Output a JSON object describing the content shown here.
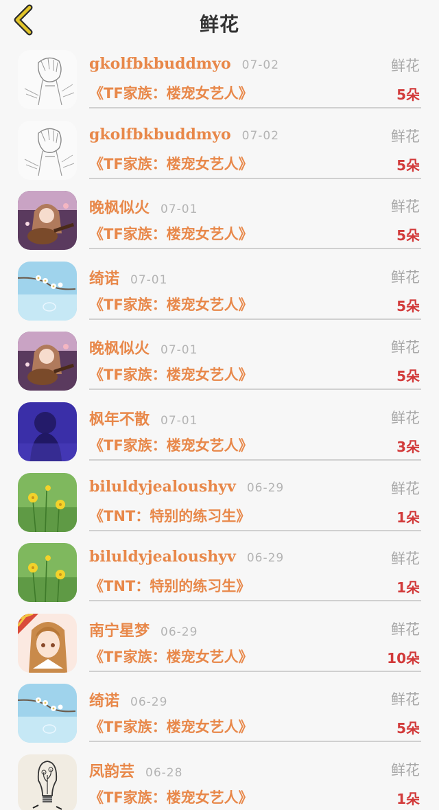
{
  "header": {
    "title": "鲜花",
    "back_icon": "chevron-left-icon",
    "accent": "#e2c52a"
  },
  "colors": {
    "username": "#e8884a",
    "book": "#e8884a",
    "count": "#d23a3a",
    "date": "#b4b4b4",
    "gift": "#a8a8a8"
  },
  "records": [
    {
      "user": "gkolfbkbuddmyo",
      "date": "07-02",
      "gift": "鲜花",
      "book": "《TF家族：楼宠女艺人》",
      "count": "5朵",
      "avatar": "sketch-boy-avatar"
    },
    {
      "user": "gkolfbkbuddmyo",
      "date": "07-02",
      "gift": "鲜花",
      "book": "《TF家族：楼宠女艺人》",
      "count": "5朵",
      "avatar": "sketch-boy-avatar"
    },
    {
      "user": "晚枫似火",
      "date": "07-01",
      "gift": "鲜花",
      "book": "《TF家族：楼宠女艺人》",
      "count": "5朵",
      "avatar": "guitar-girl-avatar"
    },
    {
      "user": "绮诺",
      "date": "07-01",
      "gift": "鲜花",
      "book": "《TF家族：楼宠女艺人》",
      "count": "5朵",
      "avatar": "blossom-sky-avatar"
    },
    {
      "user": "晚枫似火",
      "date": "07-01",
      "gift": "鲜花",
      "book": "《TF家族：楼宠女艺人》",
      "count": "5朵",
      "avatar": "guitar-girl-avatar"
    },
    {
      "user": "枫年不散",
      "date": "07-01",
      "gift": "鲜花",
      "book": "《TF家族：楼宠女艺人》",
      "count": "3朵",
      "avatar": "purple-silhouette-avatar"
    },
    {
      "user": "biluldyjealoushyv",
      "date": "06-29",
      "gift": "鲜花",
      "book": "《TNT：特别的练习生》",
      "count": "1朵",
      "avatar": "yellow-flowers-avatar"
    },
    {
      "user": "biluldyjealoushyv",
      "date": "06-29",
      "gift": "鲜花",
      "book": "《TNT：特别的练习生》",
      "count": "1朵",
      "avatar": "yellow-flowers-avatar"
    },
    {
      "user": "南宁星梦",
      "date": "06-29",
      "gift": "鲜花",
      "book": "《TF家族：楼宠女艺人》",
      "count": "10朵",
      "avatar": "anime-girl-avatar"
    },
    {
      "user": "绮诺",
      "date": "06-29",
      "gift": "鲜花",
      "book": "《TF家族：楼宠女艺人》",
      "count": "5朵",
      "avatar": "blossom-sky-avatar"
    },
    {
      "user": "凤韵芸",
      "date": "06-28",
      "gift": "鲜花",
      "book": "《TF家族：楼宠女艺人》",
      "count": "1朵",
      "avatar": "lightbulb-sketch-avatar"
    }
  ]
}
